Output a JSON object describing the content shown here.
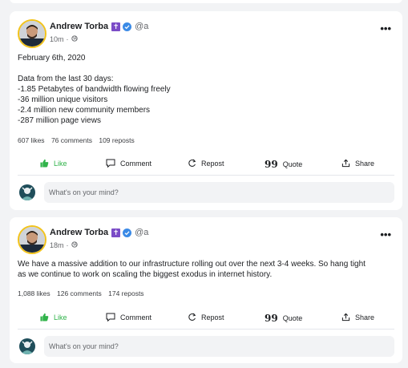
{
  "posts": [
    {
      "author": "Andrew Torba",
      "badge_glyph": "✝",
      "handle": "@a",
      "time": "10m",
      "visibility_icon": "globe-icon",
      "body_lines": [
        "February 6th, 2020",
        "",
        "Data from the last 30 days:",
        "-1.85 Petabytes of bandwidth flowing freely",
        "-36 million unique visitors",
        "-2.4 million new community members",
        "-287 million page views"
      ],
      "likes": "607 likes",
      "comments": "76 comments",
      "reposts": "109 reposts",
      "actions": {
        "like": "Like",
        "comment": "Comment",
        "repost": "Repost",
        "quote": "Quote",
        "share": "Share"
      },
      "composer_placeholder": "What's on your mind?"
    },
    {
      "author": "Andrew Torba",
      "badge_glyph": "✝",
      "handle": "@a",
      "time": "18m",
      "visibility_icon": "globe-icon",
      "body_lines": [
        "We have a massive addition to our infrastructure rolling out over the next 3-4 weeks. So hang tight",
        "as we continue to work on scaling the biggest exodus in internet history."
      ],
      "likes": "1,088 likes",
      "comments": "126 comments",
      "reposts": "174 reposts",
      "actions": {
        "like": "Like",
        "comment": "Comment",
        "repost": "Repost",
        "quote": "Quote",
        "share": "Share"
      },
      "composer_placeholder": "What's on your mind?"
    }
  ],
  "colors": {
    "like_green": "#30b34a",
    "verified_blue": "#3b8ae6",
    "badge_purple": "#7b4cc7",
    "avatar_ring": "#f2c31b"
  },
  "more_glyph": "•••"
}
